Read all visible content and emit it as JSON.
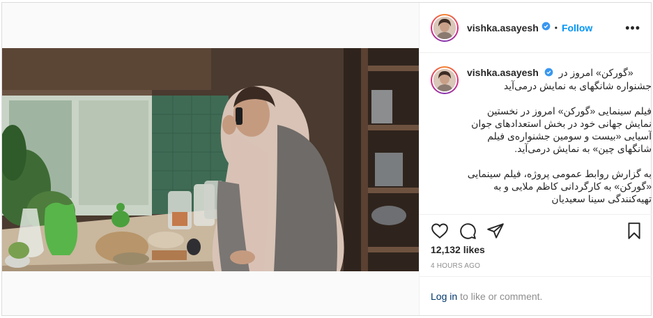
{
  "post": {
    "username": "vishka.asayesh",
    "follow_label": "Follow",
    "dot": "•",
    "more_label": "•••",
    "caption_line1": "«گورکن» امروز در",
    "caption_line2": "جشنواره شانگهای به نمایش درمی‌آید",
    "paragraph1": "فیلم سینمایی «گورکن» امروز در نخستین نمایش جهانی خود در بخش استعدادهای جوان آسیایی «بیست و سومین جشنواره‌ی فیلم شانگهای چین» به نمایش درمی‌آید.",
    "paragraph2": "به گزارش روابط عمومی پروژه، فیلم سینمایی «گورکن» به کارگردانی کاظم ملایی و به تهیه‌کنندگی سینا سعیدیان",
    "likes": "12,132 likes",
    "time": "4 HOURS AGO",
    "login_label": "Log in",
    "login_suffix": "to like or comment."
  },
  "icons": {
    "verified": "verified-badge-icon",
    "like": "heart-icon",
    "comment": "comment-icon",
    "share": "share-icon",
    "save": "bookmark-icon",
    "more": "more-options-icon"
  },
  "colors": {
    "accent": "#0095f6",
    "link": "#00376b",
    "muted": "#8e8e8e",
    "border": "#dbdbdb"
  }
}
